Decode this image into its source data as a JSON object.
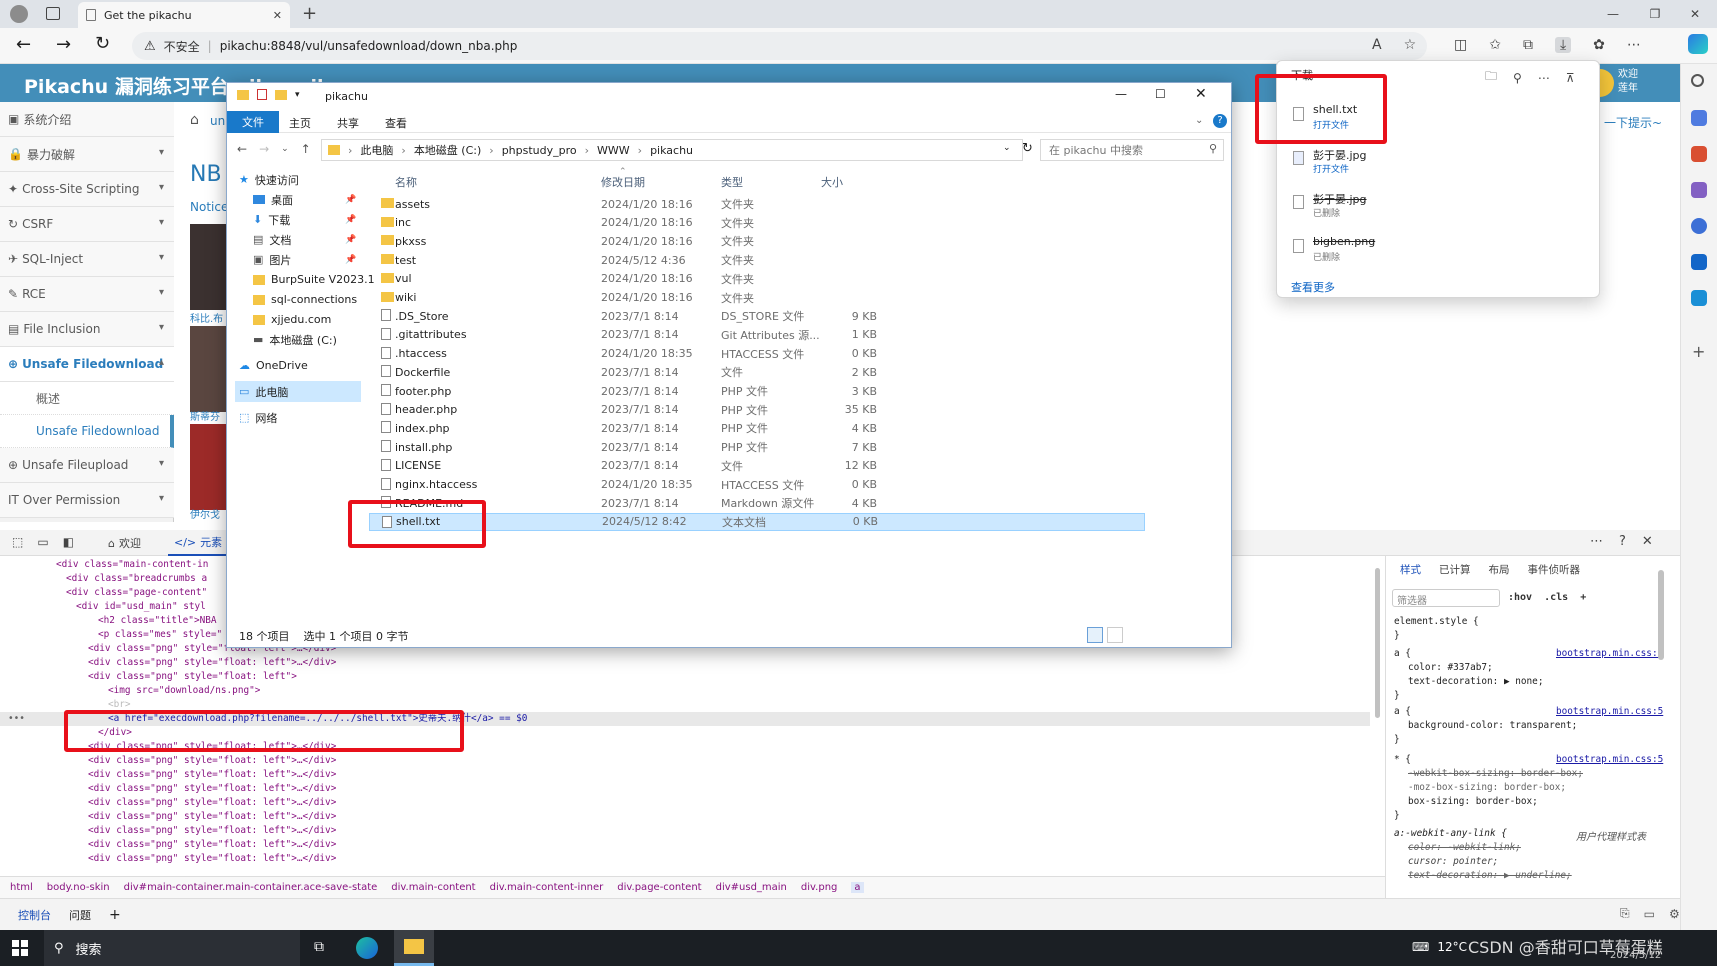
{
  "browser": {
    "tab_title": "Get the pikachu",
    "security_label": "不安全",
    "url": "pikachu:8848/vul/unsafedownload/down_nba.php"
  },
  "page": {
    "title": "Pikachu 漏洞练习平台 pika~pika~",
    "welcome": "欢迎",
    "welcome2": "莲年",
    "hint": "一下提示~",
    "heading": "NB",
    "notice": "Notice",
    "breadcrumb_partial": "un",
    "captions": [
      "科比.布",
      "斯蒂芬",
      "伊尔戈"
    ],
    "sidebar": [
      {
        "label": "系统介绍"
      },
      {
        "label": "暴力破解"
      },
      {
        "label": "Cross-Site Scripting"
      },
      {
        "label": "CSRF"
      },
      {
        "label": "SQL-Inject"
      },
      {
        "label": "RCE"
      },
      {
        "label": "File Inclusion"
      },
      {
        "label": "Unsafe Filedownload"
      },
      {
        "label": "Unsafe Fileupload"
      },
      {
        "label": "Over Permission"
      }
    ],
    "subitems": [
      "概述",
      "Unsafe Filedownload"
    ]
  },
  "explorer": {
    "window_title": "pikachu",
    "ribbon": [
      "文件",
      "主页",
      "共享",
      "查看"
    ],
    "path": [
      "此电脑",
      "本地磁盘 (C:)",
      "phpstudy_pro",
      "WWW",
      "pikachu"
    ],
    "search_placeholder": "在 pikachu 中搜索",
    "nav": [
      "快速访问",
      "桌面",
      "下载",
      "文档",
      "图片",
      "BurpSuite V2023.1",
      "sql-connections",
      "xjjedu.com",
      "本地磁盘 (C:)",
      "OneDrive",
      "此电脑",
      "网络"
    ],
    "columns": [
      "名称",
      "修改日期",
      "类型",
      "大小"
    ],
    "files": [
      {
        "name": "assets",
        "date": "2024/1/20 18:16",
        "type": "文件夹",
        "size": ""
      },
      {
        "name": "inc",
        "date": "2024/1/20 18:16",
        "type": "文件夹",
        "size": ""
      },
      {
        "name": "pkxss",
        "date": "2024/1/20 18:16",
        "type": "文件夹",
        "size": ""
      },
      {
        "name": "test",
        "date": "2024/5/12 4:36",
        "type": "文件夹",
        "size": ""
      },
      {
        "name": "vul",
        "date": "2024/1/20 18:16",
        "type": "文件夹",
        "size": ""
      },
      {
        "name": "wiki",
        "date": "2024/1/20 18:16",
        "type": "文件夹",
        "size": ""
      },
      {
        "name": ".DS_Store",
        "date": "2023/7/1 8:14",
        "type": "DS_STORE 文件",
        "size": "9 KB"
      },
      {
        "name": ".gitattributes",
        "date": "2023/7/1 8:14",
        "type": "Git Attributes 源...",
        "size": "1 KB"
      },
      {
        "name": ".htaccess",
        "date": "2024/1/20 18:35",
        "type": "HTACCESS 文件",
        "size": "0 KB"
      },
      {
        "name": "Dockerfile",
        "date": "2023/7/1 8:14",
        "type": "文件",
        "size": "2 KB"
      },
      {
        "name": "footer.php",
        "date": "2023/7/1 8:14",
        "type": "PHP 文件",
        "size": "3 KB"
      },
      {
        "name": "header.php",
        "date": "2023/7/1 8:14",
        "type": "PHP 文件",
        "size": "35 KB"
      },
      {
        "name": "index.php",
        "date": "2023/7/1 8:14",
        "type": "PHP 文件",
        "size": "4 KB"
      },
      {
        "name": "install.php",
        "date": "2023/7/1 8:14",
        "type": "PHP 文件",
        "size": "7 KB"
      },
      {
        "name": "LICENSE",
        "date": "2023/7/1 8:14",
        "type": "文件",
        "size": "12 KB"
      },
      {
        "name": "nginx.htaccess",
        "date": "2024/1/20 18:35",
        "type": "HTACCESS 文件",
        "size": "0 KB"
      },
      {
        "name": "README.md",
        "date": "2023/7/1 8:14",
        "type": "Markdown 源文件",
        "size": "4 KB"
      },
      {
        "name": "shell.txt",
        "date": "2024/5/12 8:42",
        "type": "文本文档",
        "size": "0 KB"
      }
    ],
    "status_count": "18 个项目",
    "status_selected": "选中 1 个项目  0 字节"
  },
  "downloads": {
    "title": "下载",
    "items": [
      {
        "name": "shell.txt",
        "status": "打开文件"
      },
      {
        "name": "彭于晏.jpg",
        "status": "打开文件"
      },
      {
        "name": "彭于晏.jpg",
        "status": "已删除"
      },
      {
        "name": "bigben.png",
        "status": "已删除"
      }
    ],
    "more": "查看更多"
  },
  "devtools": {
    "tabs": [
      "欢迎",
      "元素"
    ],
    "code": [
      {
        "indent": 0,
        "text": "<div class=\"main-content-in"
      },
      {
        "indent": 1,
        "text": "<div class=\"breadcrumbs a"
      },
      {
        "indent": 1,
        "text": "<div class=\"page-content\""
      },
      {
        "indent": 2,
        "text": "<div id=\"usd_main\" styl"
      },
      {
        "indent": 3,
        "text": "<h2 class=\"title\">NBA"
      },
      {
        "indent": 3,
        "text": "<p class=\"mes\" style=\""
      },
      {
        "indent": 3,
        "text": "<div class=\"png\" style=\"float: left\">…</div>"
      },
      {
        "indent": 3,
        "text": "<div class=\"png\" style=\"float: left\">…</div>"
      },
      {
        "indent": 3,
        "text": "<div class=\"png\" style=\"float: left\">"
      },
      {
        "indent": 4,
        "text": "<img src=\"download/ns.png\">"
      },
      {
        "indent": 4,
        "text": "<br>"
      },
      {
        "indent": 4,
        "text": "<a href=\"execdownload.php?filename=../../../shell.txt\">史蒂夫.纳什</a> == $0"
      },
      {
        "indent": 3,
        "text": "</div>"
      },
      {
        "indent": 3,
        "text": "<div class=\"png\" style=\"float: left\">…</div>"
      },
      {
        "indent": 3,
        "text": "<div class=\"png\" style=\"float: left\">…</div>"
      },
      {
        "indent": 3,
        "text": "<div class=\"png\" style=\"float: left\">…</div>"
      },
      {
        "indent": 3,
        "text": "<div class=\"png\" style=\"float: left\">…</div>"
      },
      {
        "indent": 3,
        "text": "<div class=\"png\" style=\"float: left\">…</div>"
      },
      {
        "indent": 3,
        "text": "<div class=\"png\" style=\"float: left\">…</div>"
      },
      {
        "indent": 3,
        "text": "<div class=\"png\" style=\"float: left\">…</div>"
      },
      {
        "indent": 3,
        "text": "<div class=\"png\" style=\"float: left\">…</div>"
      },
      {
        "indent": 3,
        "text": "<div class=\"png\" style=\"float: left\">…</div>"
      }
    ],
    "breadcrumbs": [
      "html",
      "body.no-skin",
      "div#main-container.main-container.ace-save-state",
      "div.main-content",
      "div.main-content-inner",
      "div.page-content",
      "div#usd_main",
      "div.png",
      "a"
    ],
    "styles_tabs": [
      "样式",
      "已计算",
      "布局",
      "事件侦听器"
    ],
    "filter_placeholder": "筛选器",
    "hov": ":hov",
    "cls": ".cls",
    "styles": [
      {
        "sel": "element.style {",
        "src": "",
        "props": []
      },
      {
        "sel": "a {",
        "src": "bootstrap.min.css:5",
        "props": [
          "color: #337ab7;",
          "text-decoration: ▶ none;"
        ]
      },
      {
        "sel": "a {",
        "src": "bootstrap.min.css:5",
        "props": [
          "background-color: transparent;"
        ]
      },
      {
        "sel": "* {",
        "src": "bootstrap.min.css:5",
        "props": [
          "-webkit-box-sizing: border-box;",
          "-moz-box-sizing: border-box;",
          "box-sizing: border-box;"
        ]
      },
      {
        "sel": "a:-webkit-any-link {",
        "src": "用户代理样式表",
        "props": [
          "color: -webkit-link;",
          "cursor: pointer;",
          "text-decoration: ▶ underline;"
        ]
      }
    ],
    "bottom_tabs": [
      "控制台",
      "问题"
    ]
  },
  "taskbar": {
    "search": "搜索",
    "weather": "12°C",
    "watermark": "CSDN @香甜可口草莓蛋糕",
    "date": "2024/5/12"
  },
  "colors": {
    "accent": "#438eb9",
    "highlight": "#e8101a",
    "selection": "#cce8ff"
  }
}
